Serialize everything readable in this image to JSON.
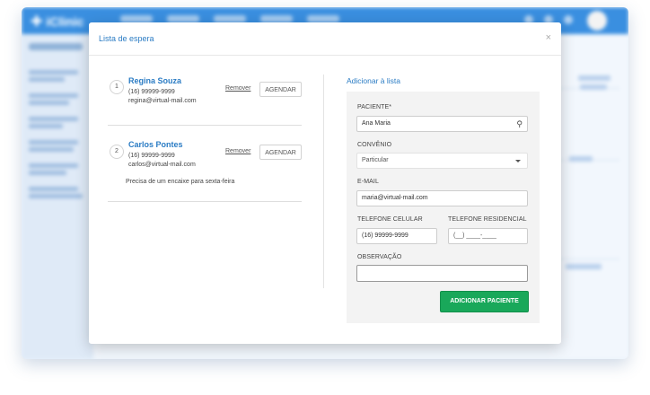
{
  "app": {
    "brand": "iClinic"
  },
  "modal": {
    "title": "Lista de espera",
    "close_label": "×"
  },
  "waitlist": {
    "remove_label": "Remover",
    "schedule_label": "AGENDAR",
    "entries": [
      {
        "number": "1",
        "name": "Regina Souza",
        "phone": "(16) 99999-9999",
        "email": "regina@virtual-mail.com",
        "note": ""
      },
      {
        "number": "2",
        "name": "Carlos Pontes",
        "phone": "(16) 99999-9999",
        "email": "carlos@virtual-mail.com",
        "note": "Precisa de um encaixe para sexta-feira"
      }
    ]
  },
  "form": {
    "title": "Adicionar à lista",
    "patient": {
      "label": "PACIENTE*",
      "value": "Ana Maria"
    },
    "insurance": {
      "label": "CONVÊNIO",
      "value": "Particular"
    },
    "email": {
      "label": "E-MAIL",
      "value": "maria@virtual-mail.com"
    },
    "mobile": {
      "label": "TELEFONE CELULAR",
      "value": "(16) 99999-9999"
    },
    "home_phone": {
      "label": "TELEFONE RESIDENCIAL",
      "value": "(__) ____-____"
    },
    "observation": {
      "label": "OBSERVAÇÃO",
      "value": ""
    },
    "submit_label": "ADICIONAR PACIENTE"
  },
  "icons": {
    "search": "search-icon",
    "dropdown": "chevron-down-icon",
    "close": "close-icon"
  },
  "colors": {
    "accent": "#2b7cc4",
    "primary_button": "#19a85a",
    "topbar": "#3a8fe0"
  }
}
